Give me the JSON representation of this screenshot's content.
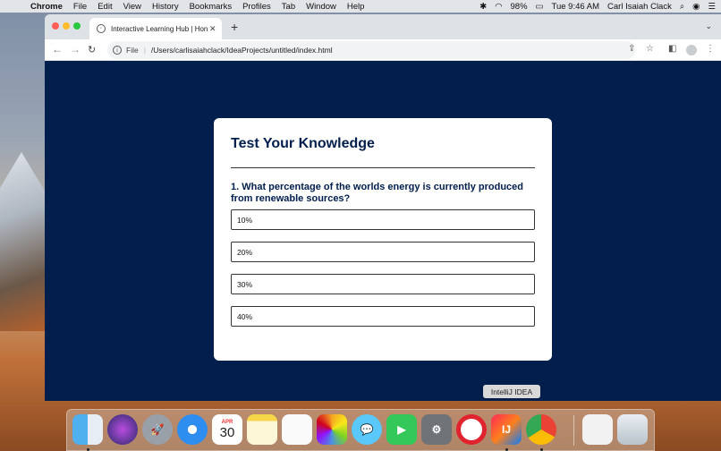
{
  "menubar": {
    "app_name": "Chrome",
    "items": [
      "File",
      "Edit",
      "View",
      "History",
      "Bookmarks",
      "Profiles",
      "Tab",
      "Window",
      "Help"
    ],
    "battery": "98%",
    "clock": "Tue 9:46 AM",
    "user": "Carl Isaiah Clack"
  },
  "browser": {
    "tab_title": "Interactive Learning Hub | Hon",
    "address_scheme": "File",
    "address_path": "/Users/carlisaiahclack/IdeaProjects/untitled/index.html"
  },
  "quiz": {
    "title": "Test Your Knowledge",
    "question": "1. What percentage of the worlds energy is currently produced from renewable sources?",
    "options": [
      "10%",
      "20%",
      "30%",
      "40%"
    ]
  },
  "dock": {
    "tooltip": "IntelliJ IDEA",
    "calendar_month": "APR",
    "calendar_day": "30",
    "items": [
      "finder-icon",
      "siri-icon",
      "launchpad-icon",
      "safari-icon",
      "calendar-icon",
      "notes-icon",
      "reminders-icon",
      "photos-icon",
      "messages-icon",
      "facetime-icon",
      "system-preferences-icon",
      "opera-icon",
      "intellij-icon",
      "chrome-icon",
      "document-icon",
      "trash-icon"
    ]
  },
  "colors": {
    "page_background": "#011e4c",
    "card_background": "#ffffff",
    "heading_color": "#011e4c"
  }
}
